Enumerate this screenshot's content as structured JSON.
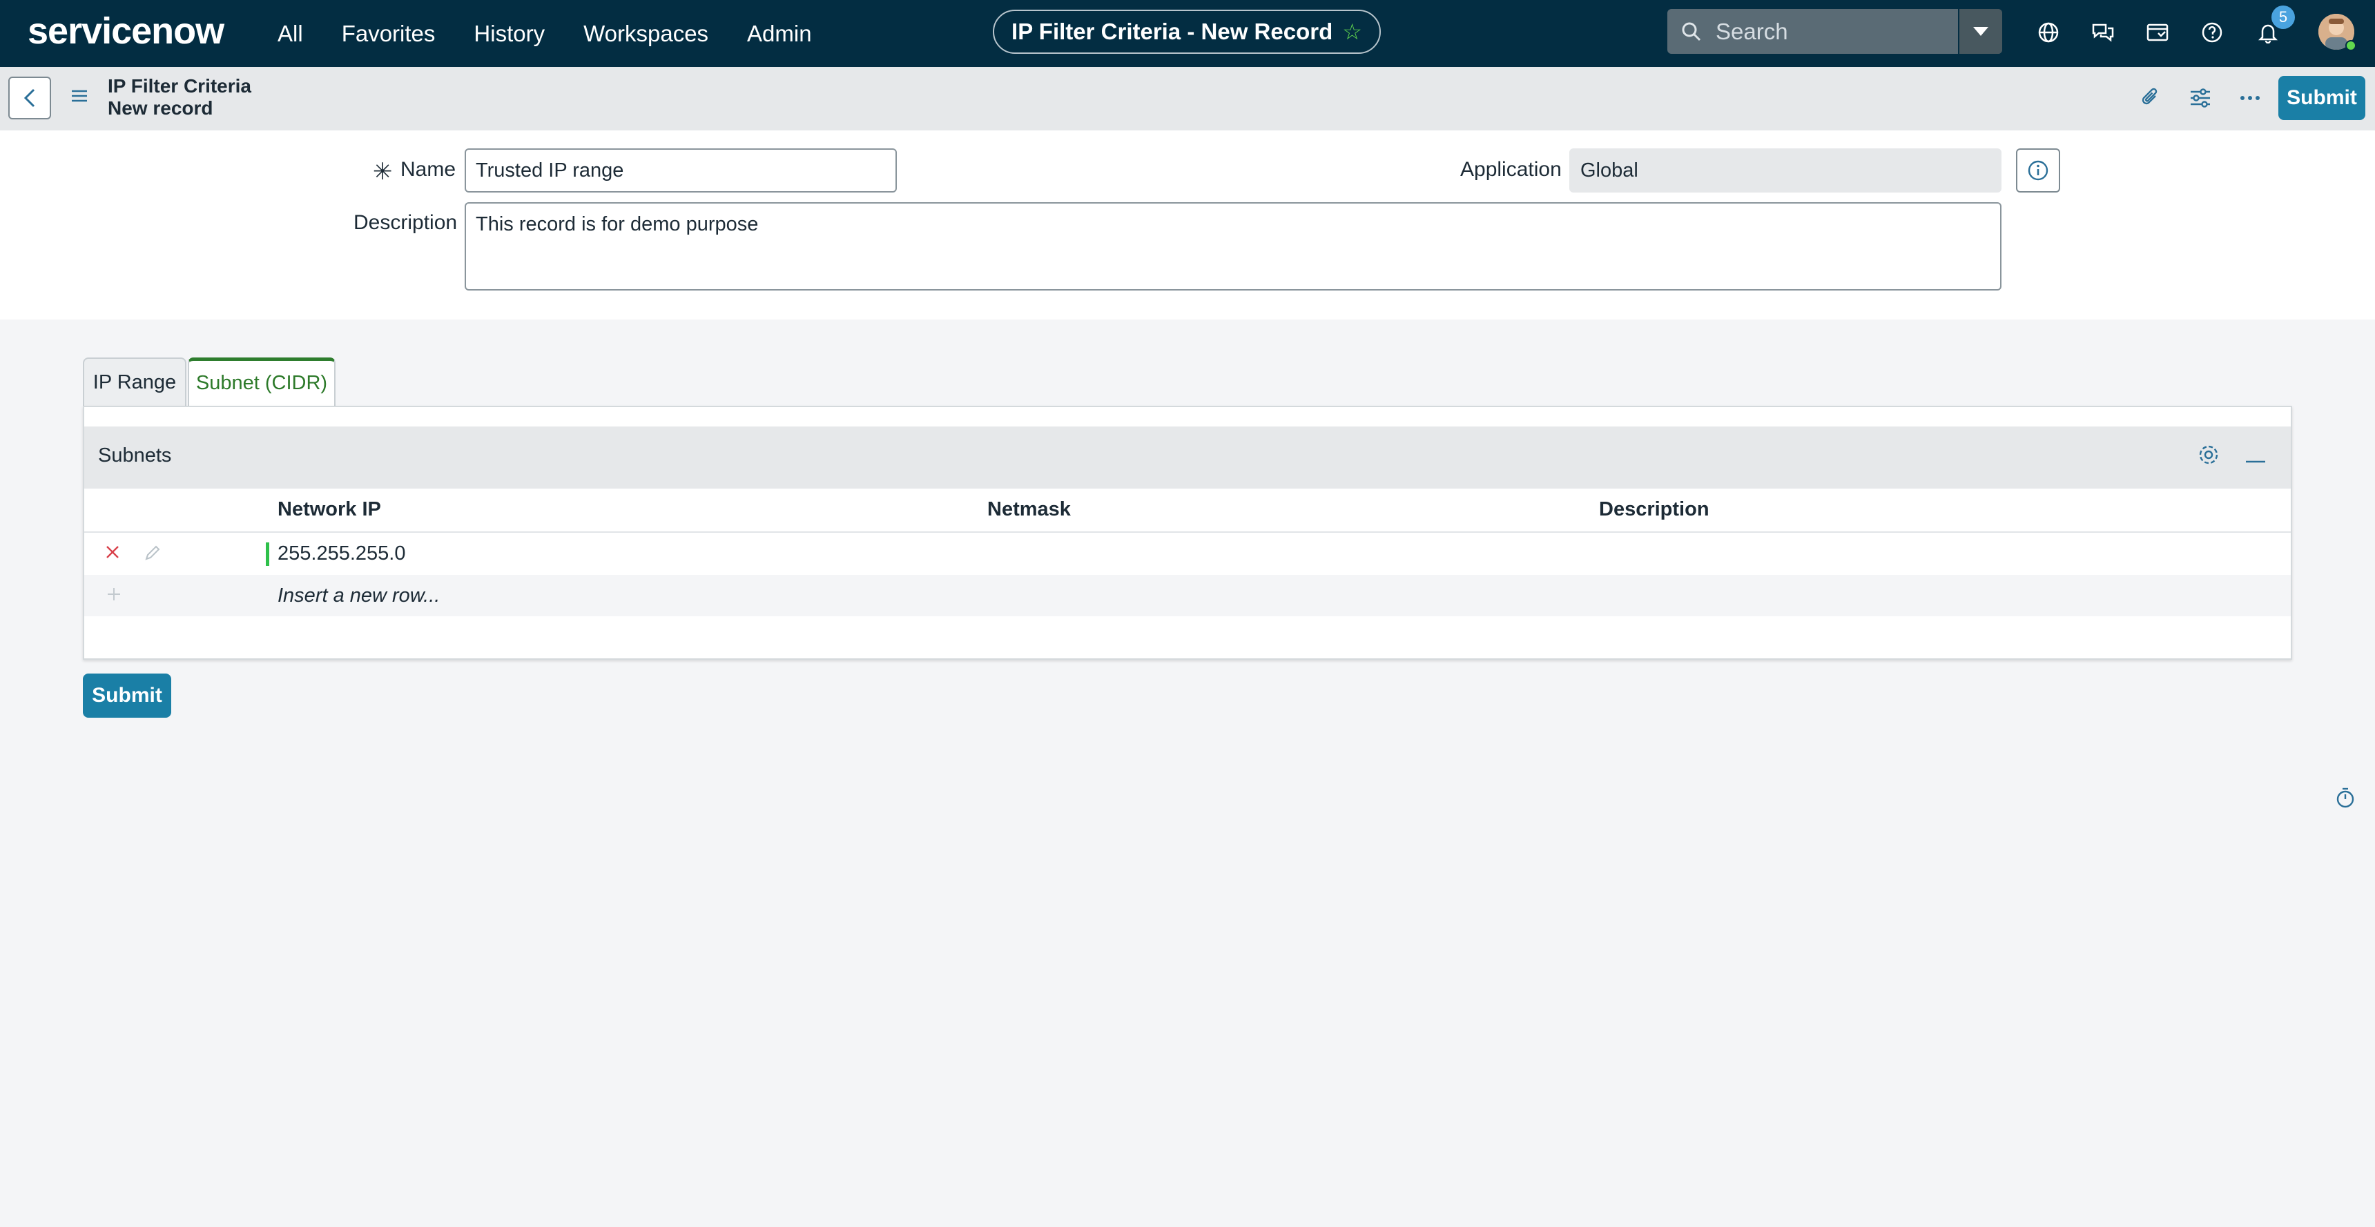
{
  "nav": {
    "logo": "servicenow",
    "links": [
      "All",
      "Favorites",
      "History",
      "Workspaces",
      "Admin"
    ],
    "record_title": "IP Filter Criteria - New Record",
    "search_placeholder": "Search",
    "notification_count": "5",
    "icons": [
      "search-icon",
      "chevron-down-icon",
      "globe-icon",
      "chat-icon",
      "inbox-icon",
      "help-icon",
      "bell-icon",
      "avatar"
    ]
  },
  "subheader": {
    "title": "IP Filter Criteria",
    "subtitle": "New record",
    "submit_label": "Submit",
    "icons": [
      "back-icon",
      "menu-icon",
      "attachment-icon",
      "sliders-icon",
      "more-icon"
    ]
  },
  "form": {
    "name_label": "Name",
    "name_value": "Trusted IP range",
    "application_label": "Application",
    "application_value": "Global",
    "description_label": "Description",
    "description_value": "This record is for demo purpose"
  },
  "tabs": [
    {
      "label": "IP Range",
      "active": false
    },
    {
      "label": "Subnet (CIDR)",
      "active": true
    }
  ],
  "related_list": {
    "title": "Subnets",
    "columns": [
      "Network IP",
      "Netmask",
      "Description"
    ],
    "rows": [
      {
        "network_ip": "255.255.255.0",
        "netmask": "",
        "description": ""
      }
    ],
    "insert_placeholder": "Insert a new row..."
  },
  "footer": {
    "submit_label": "Submit"
  },
  "colors": {
    "nav_bg": "#032d42",
    "accent": "#1a7fa6",
    "brand_green": "#62d84e",
    "active_tab": "#2e7d2e"
  }
}
